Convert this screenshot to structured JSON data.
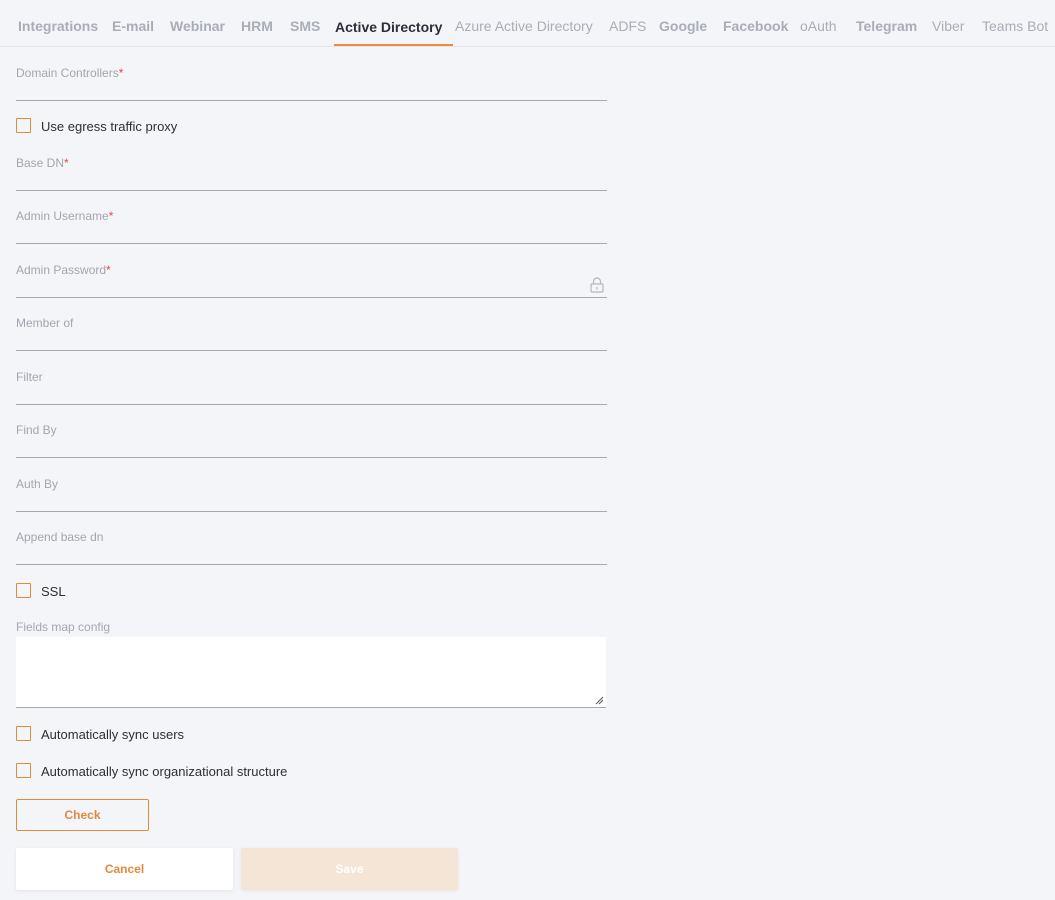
{
  "tabs": [
    {
      "label": "Integrations",
      "active": false
    },
    {
      "label": "E-mail",
      "active": false
    },
    {
      "label": "Webinar",
      "active": false
    },
    {
      "label": "HRM",
      "active": false
    },
    {
      "label": "SMS",
      "active": false
    },
    {
      "label": "Active Directory",
      "active": true
    },
    {
      "label": "Azure Active Directory",
      "active": false
    },
    {
      "label": "ADFS",
      "active": false
    },
    {
      "label": "Google",
      "active": false
    },
    {
      "label": "Facebook",
      "active": false
    },
    {
      "label": "oAuth",
      "active": false
    },
    {
      "label": "Telegram",
      "active": false
    },
    {
      "label": "Viber",
      "active": false
    },
    {
      "label": "Teams Bot",
      "active": false
    }
  ],
  "colors": {
    "accent": "#e08a3c",
    "required": "#e2474b",
    "background": "#f4f5f9"
  },
  "form": {
    "domain_controllers": {
      "label": "Domain Controllers",
      "required_mark": "*",
      "value": ""
    },
    "egress_proxy": {
      "label": "Use egress traffic proxy",
      "checked": false
    },
    "base_dn": {
      "label": "Base DN",
      "required_mark": "*",
      "value": ""
    },
    "admin_username": {
      "label": "Admin Username",
      "required_mark": "*",
      "value": ""
    },
    "admin_password": {
      "label": "Admin Password",
      "required_mark": "*",
      "value": "",
      "icon": "lock-icon"
    },
    "member_of": {
      "label": "Member of",
      "value": ""
    },
    "filter": {
      "label": "Filter",
      "value": ""
    },
    "find_by": {
      "label": "Find By",
      "value": ""
    },
    "auth_by": {
      "label": "Auth By",
      "value": ""
    },
    "append_base_dn": {
      "label": "Append base dn",
      "value": ""
    },
    "ssl": {
      "label": "SSL",
      "checked": false
    },
    "fields_map_config": {
      "label": "Fields map config",
      "value": ""
    },
    "auto_sync_users": {
      "label": "Automatically sync users",
      "checked": false
    },
    "auto_sync_org": {
      "label": "Automatically sync organizational structure",
      "checked": false
    }
  },
  "buttons": {
    "check": "Check",
    "cancel": "Cancel",
    "save": "Save"
  }
}
